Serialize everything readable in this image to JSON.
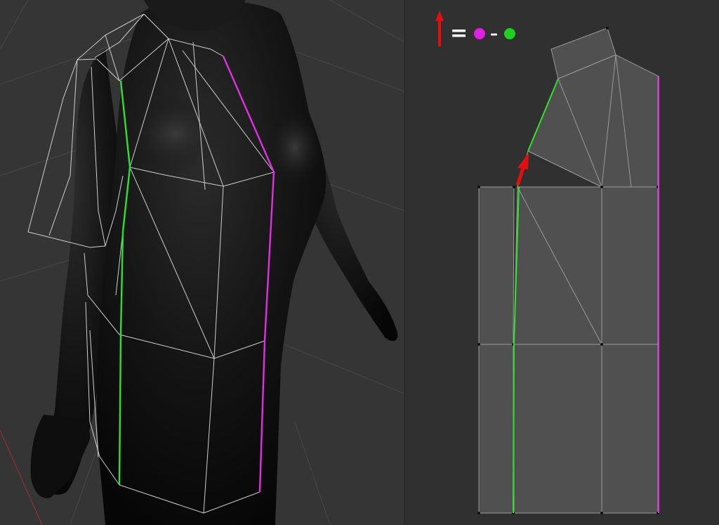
{
  "legend": {
    "arrow_color": "#e01010",
    "equals_symbol": "=",
    "minus_symbol": "–",
    "dot_a_color": "#e020e0",
    "dot_b_color": "#20d020"
  },
  "colors": {
    "viewport_bg": "#353535",
    "uv_bg": "#303030",
    "grid": "#4a4a4a",
    "wire": "#cfcfcf",
    "body": "#101010",
    "seam_green": "#30e030",
    "seam_magenta": "#e030e0",
    "uv_face": "#505050",
    "uv_edge": "#9a9a9a"
  },
  "icons": {
    "arrow": "red-arrow-up-icon",
    "dot_a": "magenta-dot-icon",
    "dot_b": "green-dot-icon"
  }
}
